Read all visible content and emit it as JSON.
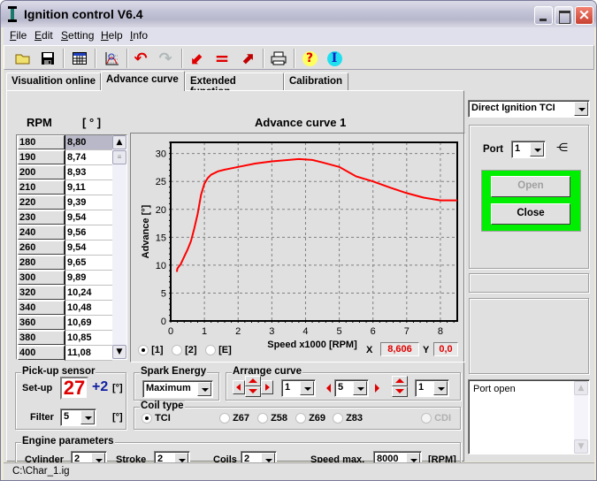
{
  "window": {
    "title": "Ignition control V6.4",
    "controls": {
      "minimize": "minimize",
      "maximize": "maximize",
      "close": "×"
    }
  },
  "menu": [
    {
      "label": "File",
      "hotkey": "F",
      "rest": "ile"
    },
    {
      "label": "Edit",
      "hotkey": "E",
      "rest": "dit"
    },
    {
      "label": "Setting",
      "hotkey": "S",
      "rest": "etting"
    },
    {
      "label": "Help",
      "hotkey": "H",
      "rest": "elp"
    },
    {
      "label": "Info",
      "hotkey": "I",
      "rest": "nfo"
    }
  ],
  "toolbar": [
    {
      "name": "open-folder",
      "glyph": "📂"
    },
    {
      "name": "save",
      "glyph": "💾"
    },
    {
      "name": "table",
      "glyph": "▦"
    },
    {
      "name": "chart",
      "glyph": "📈"
    },
    {
      "name": "undo",
      "glyph": "↶"
    },
    {
      "name": "redo",
      "glyph": "↷"
    },
    {
      "name": "arrow-down-left",
      "glyph": "⬋"
    },
    {
      "name": "equals",
      "glyph": "="
    },
    {
      "name": "arrow-up-right",
      "glyph": "⬈"
    },
    {
      "name": "print",
      "glyph": "🖶"
    },
    {
      "name": "help",
      "glyph": "?"
    },
    {
      "name": "info",
      "glyph": "I"
    }
  ],
  "tabs": [
    {
      "label": "Visualition online",
      "active": false
    },
    {
      "label": "Advance curve",
      "active": true
    },
    {
      "label": "Extended function",
      "active": false
    },
    {
      "label": "Calibration",
      "active": false
    }
  ],
  "table": {
    "header_rpm": "RPM",
    "header_deg": "[ ° ]",
    "rows": [
      {
        "rpm": "180",
        "deg": "8,80",
        "selected": true
      },
      {
        "rpm": "190",
        "deg": "8,74"
      },
      {
        "rpm": "200",
        "deg": "8,93"
      },
      {
        "rpm": "210",
        "deg": "9,11"
      },
      {
        "rpm": "220",
        "deg": "9,39"
      },
      {
        "rpm": "230",
        "deg": "9,54"
      },
      {
        "rpm": "240",
        "deg": "9,56"
      },
      {
        "rpm": "260",
        "deg": "9,54"
      },
      {
        "rpm": "280",
        "deg": "9,65"
      },
      {
        "rpm": "300",
        "deg": "9,89"
      },
      {
        "rpm": "320",
        "deg": "10,24"
      },
      {
        "rpm": "340",
        "deg": "10,48"
      },
      {
        "rpm": "360",
        "deg": "10,69"
      },
      {
        "rpm": "380",
        "deg": "10,85"
      },
      {
        "rpm": "400",
        "deg": "11,08"
      }
    ]
  },
  "chart_data": {
    "type": "line",
    "title": "Advance curve 1",
    "xlabel": "Speed x1000 [RPM]",
    "ylabel": "Advance [°]",
    "xlim": [
      0,
      8.5
    ],
    "ylim": [
      0,
      32
    ],
    "xticks": [
      0,
      1,
      2,
      3,
      4,
      5,
      6,
      7,
      8
    ],
    "yticks": [
      0,
      5,
      10,
      15,
      20,
      25,
      30
    ],
    "grid": true,
    "line_color": "#ff0000",
    "series": [
      {
        "name": "Advance curve 1",
        "x": [
          0.18,
          0.2,
          0.3,
          0.4,
          0.5,
          0.6,
          0.7,
          0.8,
          0.9,
          1.0,
          1.1,
          1.2,
          1.4,
          1.6,
          2.0,
          2.5,
          3.0,
          3.5,
          3.8,
          4.2,
          4.5,
          5.0,
          5.5,
          6.0,
          6.5,
          7.0,
          7.5,
          8.0,
          8.5
        ],
        "y": [
          8.8,
          9.4,
          10.2,
          11.5,
          12.8,
          14.3,
          16.6,
          19.2,
          22.6,
          24.6,
          25.6,
          26.2,
          26.8,
          27.1,
          27.6,
          28.2,
          28.6,
          28.85,
          29.0,
          28.85,
          28.4,
          27.6,
          25.9,
          25.0,
          23.9,
          22.9,
          22.1,
          21.6,
          21.6
        ]
      }
    ],
    "curve_select": [
      {
        "label": "[1]",
        "checked": true
      },
      {
        "label": "[2]",
        "checked": false
      },
      {
        "label": "[E]",
        "checked": false
      }
    ],
    "readout": {
      "x_label": "X",
      "x_value": "8,606",
      "y_label": "Y",
      "y_value": "0,0"
    }
  },
  "pickup": {
    "title": "Pick-up sensor",
    "setup_label": "Set-up",
    "setup_value": "27",
    "offset": "+2",
    "unit": "[°]",
    "filter_label": "Filter",
    "filter_value": "5",
    "filter_unit": "[°]"
  },
  "spark": {
    "title": "Spark Energy",
    "value": "Maximum"
  },
  "arrange": {
    "title": "Arrange curve",
    "combo1": "1",
    "combo2": "5",
    "combo3": "1"
  },
  "coil": {
    "title": "Coil type",
    "options": [
      {
        "label": "TCI",
        "checked": true,
        "enabled": true
      },
      {
        "label": "Z67",
        "checked": false,
        "enabled": true
      },
      {
        "label": "Z58",
        "checked": false,
        "enabled": true
      },
      {
        "label": "Z69",
        "checked": false,
        "enabled": true
      },
      {
        "label": "Z83",
        "checked": false,
        "enabled": true
      },
      {
        "label": "CDI",
        "checked": false,
        "enabled": false
      }
    ]
  },
  "engine": {
    "title": "Engine parameters",
    "cylinder_label": "Cylinder",
    "cylinder_value": "2",
    "stroke_label": "Stroke",
    "stroke_value": "2",
    "coils_label": "Coils",
    "coils_value": "2",
    "speed_label": "Speed max.",
    "speed_value": "8000",
    "speed_unit": "[RPM]"
  },
  "right": {
    "mode_value": "Direct Ignition TCI",
    "port_label": "Port",
    "port_value": "1",
    "open_label": "Open",
    "close_label": "Close",
    "connection_color": "#00ee00",
    "log": [
      "Port open"
    ]
  },
  "status": {
    "file": "C:\\Char_1.ig"
  }
}
